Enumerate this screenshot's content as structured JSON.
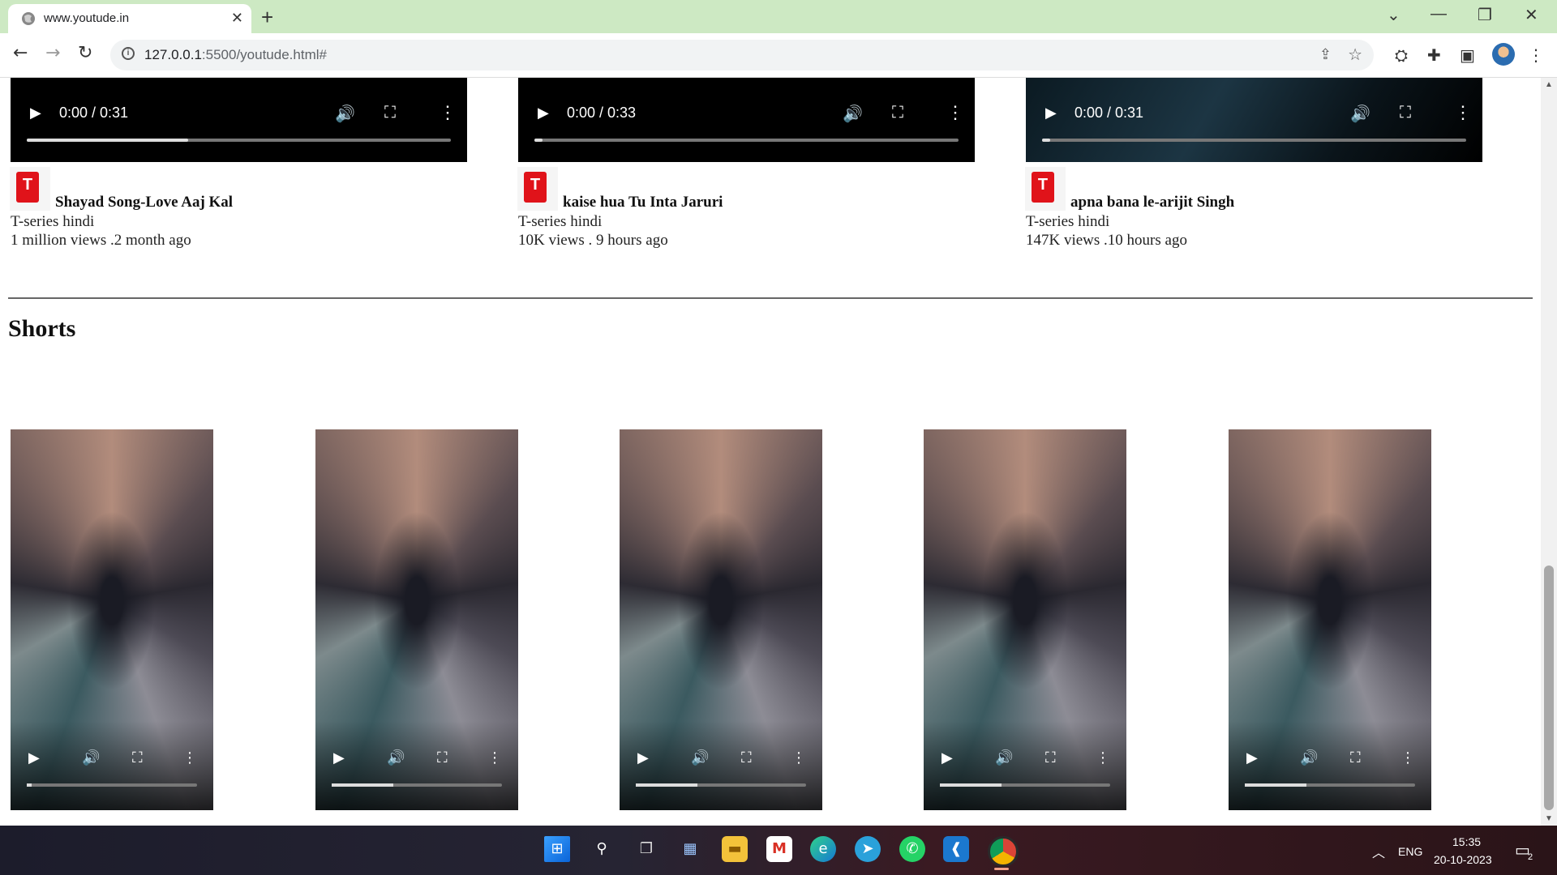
{
  "browser": {
    "tab_title": "www.youtude.in",
    "url_host": "127.0.0.1",
    "url_rest": ":5500/youtude.html#"
  },
  "videos": [
    {
      "time": "0:00 / 0:31",
      "progress": 0.38,
      "title": "Shayad Song-Love Aaj Kal",
      "channel": "T-series hindi",
      "stats": "1 million views .2 month ago"
    },
    {
      "time": "0:00 / 0:33",
      "progress": 0.02,
      "title": "kaise hua Tu Inta Jaruri",
      "channel": "T-series hindi",
      "stats": "10K views . 9 hours ago"
    },
    {
      "time": "0:00 / 0:31",
      "progress": 0.02,
      "title": "apna bana le-arijit Singh",
      "channel": "T-series hindi",
      "stats": "147K views .10 hours ago"
    }
  ],
  "shorts_heading": "Shorts",
  "shorts_progress": [
    0.03,
    0.36,
    0.36,
    0.36,
    0.36
  ],
  "taskbar": {
    "lang": "ENG",
    "time": "15:35",
    "date": "20-10-2023",
    "notifications": "2"
  },
  "colors": {
    "tab_bar": "#cde9c3",
    "logo_red": "#e0131a"
  }
}
